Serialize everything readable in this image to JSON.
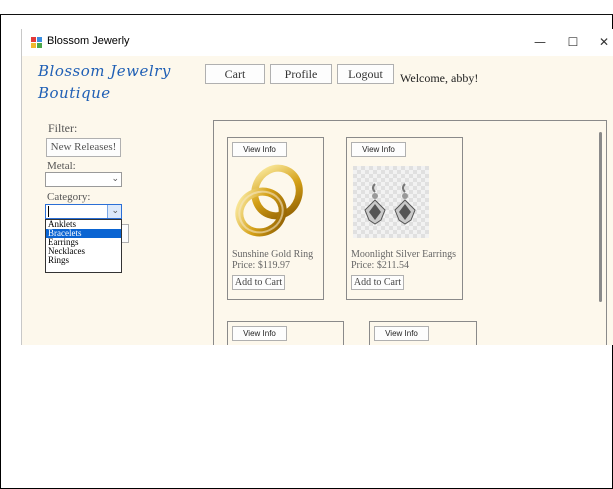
{
  "window": {
    "title": "Blossom Jewerly",
    "minimize_glyph": "—",
    "maximize_glyph": "☐",
    "close_glyph": "✕"
  },
  "logo": {
    "line1": "Blossom Jewelry",
    "line2": "Boutique"
  },
  "nav": {
    "cart": "Cart",
    "profile": "Profile",
    "logout": "Logout",
    "welcome": "Welcome, abby!"
  },
  "filter": {
    "title": "Filter:",
    "new_releases": "New Releases!",
    "metal_label": "Metal:",
    "metal_value": "",
    "category_label": "Category:",
    "category_value": "",
    "category_options": [
      "Anklets",
      "Bracelets",
      "Earrings",
      "Necklaces",
      "Rings"
    ],
    "category_highlighted": "Bracelets"
  },
  "products": [
    {
      "view_label": "View Info",
      "name": "Sunshine Gold Ring",
      "price": "Price: $119.97",
      "add_label": "Add to Cart",
      "image_icon": "gold-rings-icon"
    },
    {
      "view_label": "View Info",
      "name": "Moonlight Silver Earrings",
      "price": "Price: $211.54",
      "add_label": "Add to Cart",
      "image_icon": "silver-earrings-icon"
    },
    {
      "view_label": "View Info"
    },
    {
      "view_label": "View Info"
    }
  ],
  "colors": {
    "background": "#fdf8ec",
    "logo": "#1f5fb5",
    "selection": "#0a64d2"
  }
}
